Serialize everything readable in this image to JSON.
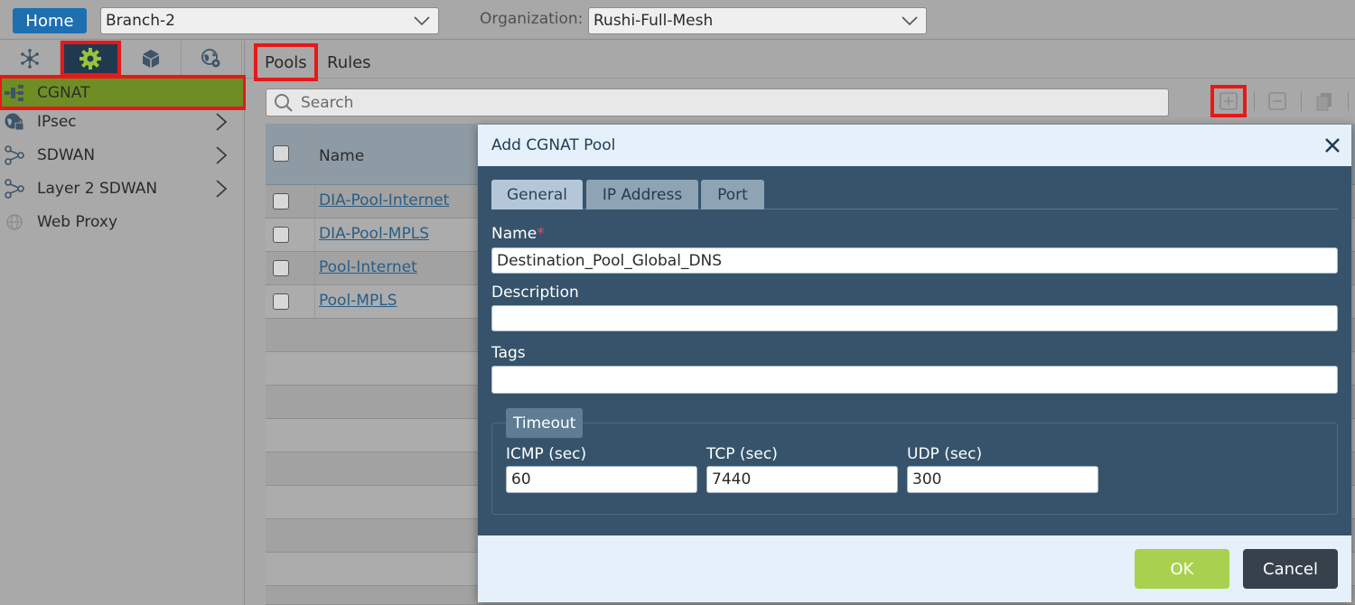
{
  "topbar": {
    "home_label": "Home",
    "appliance_value": "Branch-2",
    "org_label": "Organization:",
    "org_value": "Rushi-Full-Mesh"
  },
  "sidebar": {
    "items": [
      {
        "label": "CGNAT",
        "icon": "cgnat-icon",
        "active": true
      },
      {
        "label": "IPsec",
        "icon": "ipsec-icon",
        "has_children": true
      },
      {
        "label": "SDWAN",
        "icon": "sdwan-icon",
        "has_children": true
      },
      {
        "label": "Layer 2 SDWAN",
        "icon": "sdwan-icon",
        "has_children": true
      },
      {
        "label": "Web Proxy",
        "icon": "globe-icon"
      }
    ]
  },
  "main": {
    "tabs": [
      {
        "label": "Pools"
      },
      {
        "label": "Rules"
      }
    ],
    "search_placeholder": "Search",
    "table": {
      "name_header": "Name",
      "rows": [
        {
          "name": "DIA-Pool-Internet"
        },
        {
          "name": "DIA-Pool-MPLS"
        },
        {
          "name": "Pool-Internet"
        },
        {
          "name": "Pool-MPLS"
        }
      ]
    }
  },
  "modal": {
    "title": "Add CGNAT Pool",
    "tabs": [
      {
        "label": "General"
      },
      {
        "label": "IP Address"
      },
      {
        "label": "Port"
      }
    ],
    "name_label": "Name",
    "required_mark": "*",
    "name_value": "Destination_Pool_Global_DNS",
    "description_label": "Description",
    "description_value": "",
    "tags_label": "Tags",
    "tags_value": "",
    "timeout": {
      "legend": "Timeout",
      "icmp_label": "ICMP (sec)",
      "icmp_value": "60",
      "tcp_label": "TCP (sec)",
      "tcp_value": "7440",
      "udp_label": "UDP (sec)",
      "udp_value": "300"
    },
    "ok_label": "OK",
    "cancel_label": "Cancel"
  },
  "colors": {
    "home_button": "#1d6fb0",
    "active_nav": "#6e8e25",
    "highlight_outline": "#e81818",
    "modal_body": "#36536b",
    "ok_button": "#a9d14f",
    "cancel_button": "#36414b"
  }
}
